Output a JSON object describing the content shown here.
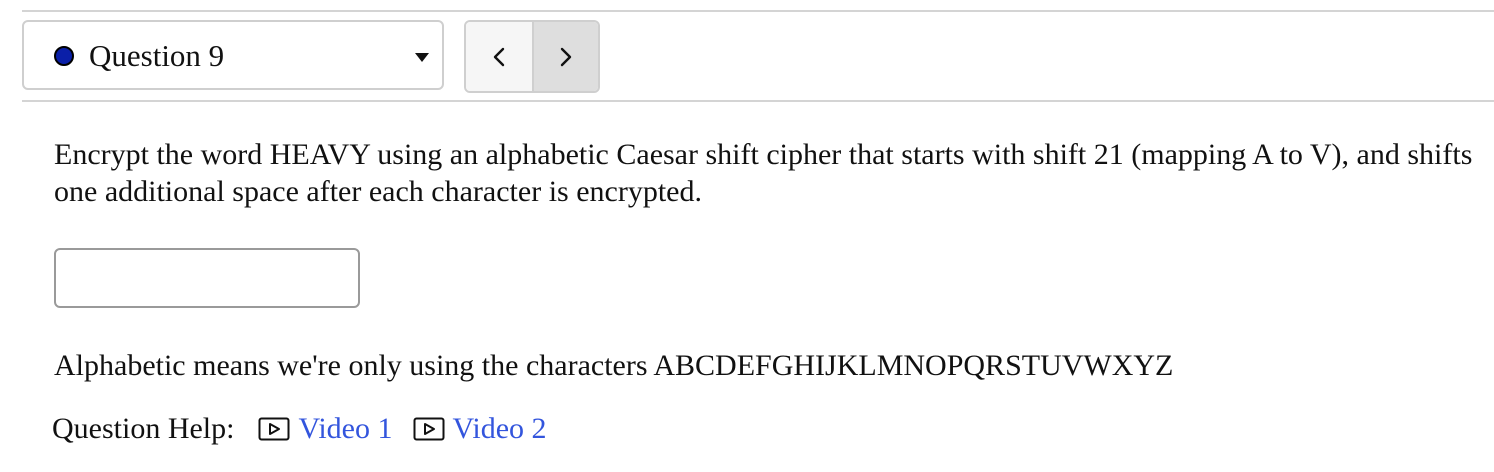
{
  "question_selector": {
    "label": "Question 9",
    "status_color": "#0a1fa8",
    "icon": "caret-down-icon"
  },
  "navigation": {
    "prev_icon": "chevron-left-icon",
    "next_icon": "chevron-right-icon"
  },
  "prompt": {
    "text": "Encrypt the word HEAVY using an alphabetic Caesar shift cipher that starts with shift 21 (mapping A to V), and shifts one additional space after each character is encrypted."
  },
  "answer": {
    "value": "",
    "placeholder": ""
  },
  "note": {
    "text": "Alphabetic means we're only using the characters ABCDEFGHIJKLMNOPQRSTUVWXYZ"
  },
  "help": {
    "label": "Question Help:",
    "links": [
      {
        "label": "Video 1",
        "icon": "video-play-icon"
      },
      {
        "label": "Video 2",
        "icon": "video-play-icon"
      }
    ],
    "link_color": "#3355dd"
  }
}
